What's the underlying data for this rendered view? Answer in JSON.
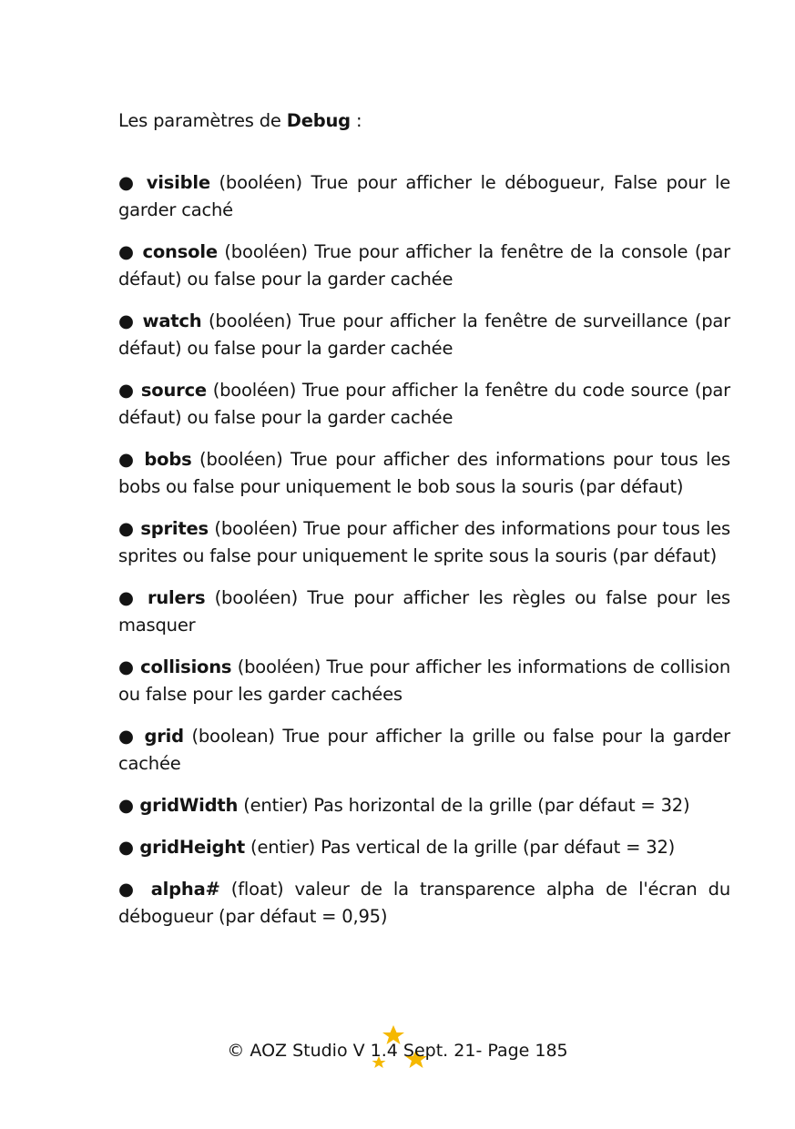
{
  "intro": {
    "prefix": "Les paramètres de ",
    "keyword": "Debug",
    "suffix": " :"
  },
  "bullet": "●",
  "params": [
    {
      "name": "visible",
      "desc": " (booléen) True pour afficher le débogueur, False pour le garder caché"
    },
    {
      "name": "console",
      "desc": " (booléen) True pour afficher la fenêtre de la console (par défaut) ou false pour la garder cachée"
    },
    {
      "name": "watch",
      "desc": " (booléen) True pour afficher la fenêtre de surveillance (par défaut) ou false pour la garder cachée"
    },
    {
      "name": "source",
      "desc": " (booléen) True pour afficher la fenêtre du code source (par défaut) ou false pour la garder cachée"
    },
    {
      "name": "bobs",
      "desc": " (booléen) True pour afficher des informations pour tous les bobs ou false pour uniquement le bob sous la souris (par défaut)"
    },
    {
      "name": "sprites",
      "desc": " (booléen) True pour afficher des informations pour tous les sprites ou false pour uniquement le sprite sous la souris (par défaut)"
    },
    {
      "name": "rulers",
      "desc": " (booléen) True pour afficher les règles ou false pour les masquer"
    },
    {
      "name": "collisions",
      "desc": " (booléen) True pour afficher les informations de collision ou false pour les garder cachées"
    },
    {
      "name": "grid",
      "desc": " (boolean) True pour afficher la grille ou false pour la garder cachée"
    },
    {
      "name": "gridWidth",
      "desc": " (entier) Pas horizontal de la grille (par défaut = 32)"
    },
    {
      "name": "gridHeight",
      "desc": " (entier) Pas vertical de la grille (par défaut = 32)"
    },
    {
      "name": "alpha#",
      "desc": " (float) valeur de la transparence alpha de l'écran du débogueur (par défaut = 0,95)"
    }
  ],
  "footer": "© AOZ Studio V 1.4  Sept. 21- Page 185",
  "colors": {
    "text": "#141414",
    "star": "#f5b800"
  }
}
